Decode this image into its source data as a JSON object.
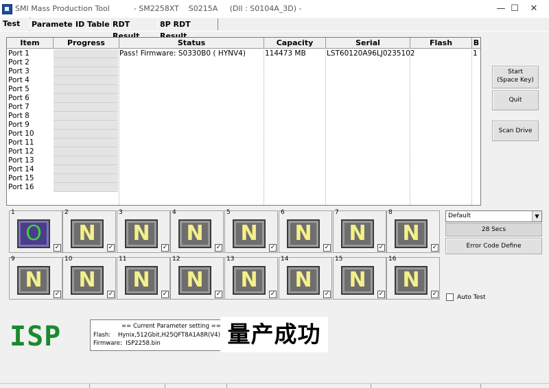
{
  "window": {
    "title": "SMI Mass Production Tool          - SM2258XT    S0215A     (Dll : S0104A_3D) -",
    "minimize": "—",
    "maximize": "☐",
    "close": "✕"
  },
  "tabs": [
    {
      "label": "Test"
    },
    {
      "label": "Parameter"
    },
    {
      "label": "ID Table"
    },
    {
      "label": "RDT Result"
    },
    {
      "label": "8P RDT Result"
    }
  ],
  "grid": {
    "headers": [
      "Item",
      "Progress",
      "Status",
      "Capacity",
      "Serial",
      "Flash",
      "B"
    ],
    "rows": [
      {
        "item": "Port 1",
        "status": "Pass! Firmware: S0330B0 ( HYNV4)",
        "capacity": "114473 MB",
        "serial": "LST60120A96LJ0235102",
        "b": "1"
      },
      {
        "item": "Port 2"
      },
      {
        "item": "Port 3"
      },
      {
        "item": "Port 4"
      },
      {
        "item": "Port 5"
      },
      {
        "item": "Port 6"
      },
      {
        "item": "Port 7"
      },
      {
        "item": "Port 8"
      },
      {
        "item": "Port 9"
      },
      {
        "item": "Port 10"
      },
      {
        "item": "Port 11"
      },
      {
        "item": "Port 12"
      },
      {
        "item": "Port 13"
      },
      {
        "item": "Port 14"
      },
      {
        "item": "Port 15"
      },
      {
        "item": "Port 16"
      }
    ]
  },
  "slots": [
    {
      "num": "1",
      "letter": "O",
      "pass": true
    },
    {
      "num": "2",
      "letter": "N"
    },
    {
      "num": "3",
      "letter": "N"
    },
    {
      "num": "4",
      "letter": "N"
    },
    {
      "num": "5",
      "letter": "N"
    },
    {
      "num": "6",
      "letter": "N"
    },
    {
      "num": "7",
      "letter": "N"
    },
    {
      "num": "8",
      "letter": "N"
    },
    {
      "num": "9",
      "letter": "N"
    },
    {
      "num": "10",
      "letter": "N"
    },
    {
      "num": "11",
      "letter": "N"
    },
    {
      "num": "12",
      "letter": "N"
    },
    {
      "num": "13",
      "letter": "N"
    },
    {
      "num": "14",
      "letter": "N"
    },
    {
      "num": "15",
      "letter": "N"
    },
    {
      "num": "16",
      "letter": "N"
    }
  ],
  "checkmark": "✓",
  "buttons": {
    "start_line1": "Start",
    "start_line2": "(Space Key)",
    "quit": "Quit",
    "scan_drive": "Scan Drive",
    "error_code_define": "Error Code Define"
  },
  "profile_select": {
    "value": "Default"
  },
  "elapsed": "28 Secs",
  "auto_test_label": "Auto Test",
  "isp_label": "ISP",
  "param_box": {
    "title": "== Current Parameter setting ==",
    "flash_label": "Flash:",
    "flash_value": "Hynix,512Gbit,H25QFT8A1A8R(V4)",
    "firmware_label": "Firmware:",
    "firmware_value": "ISP2258.bin"
  },
  "success_text": "量产成功",
  "colors": {
    "isp_green": "#1b8a2e",
    "pass_led": "#3cd13c",
    "fail_letter": "#f4f08a"
  }
}
